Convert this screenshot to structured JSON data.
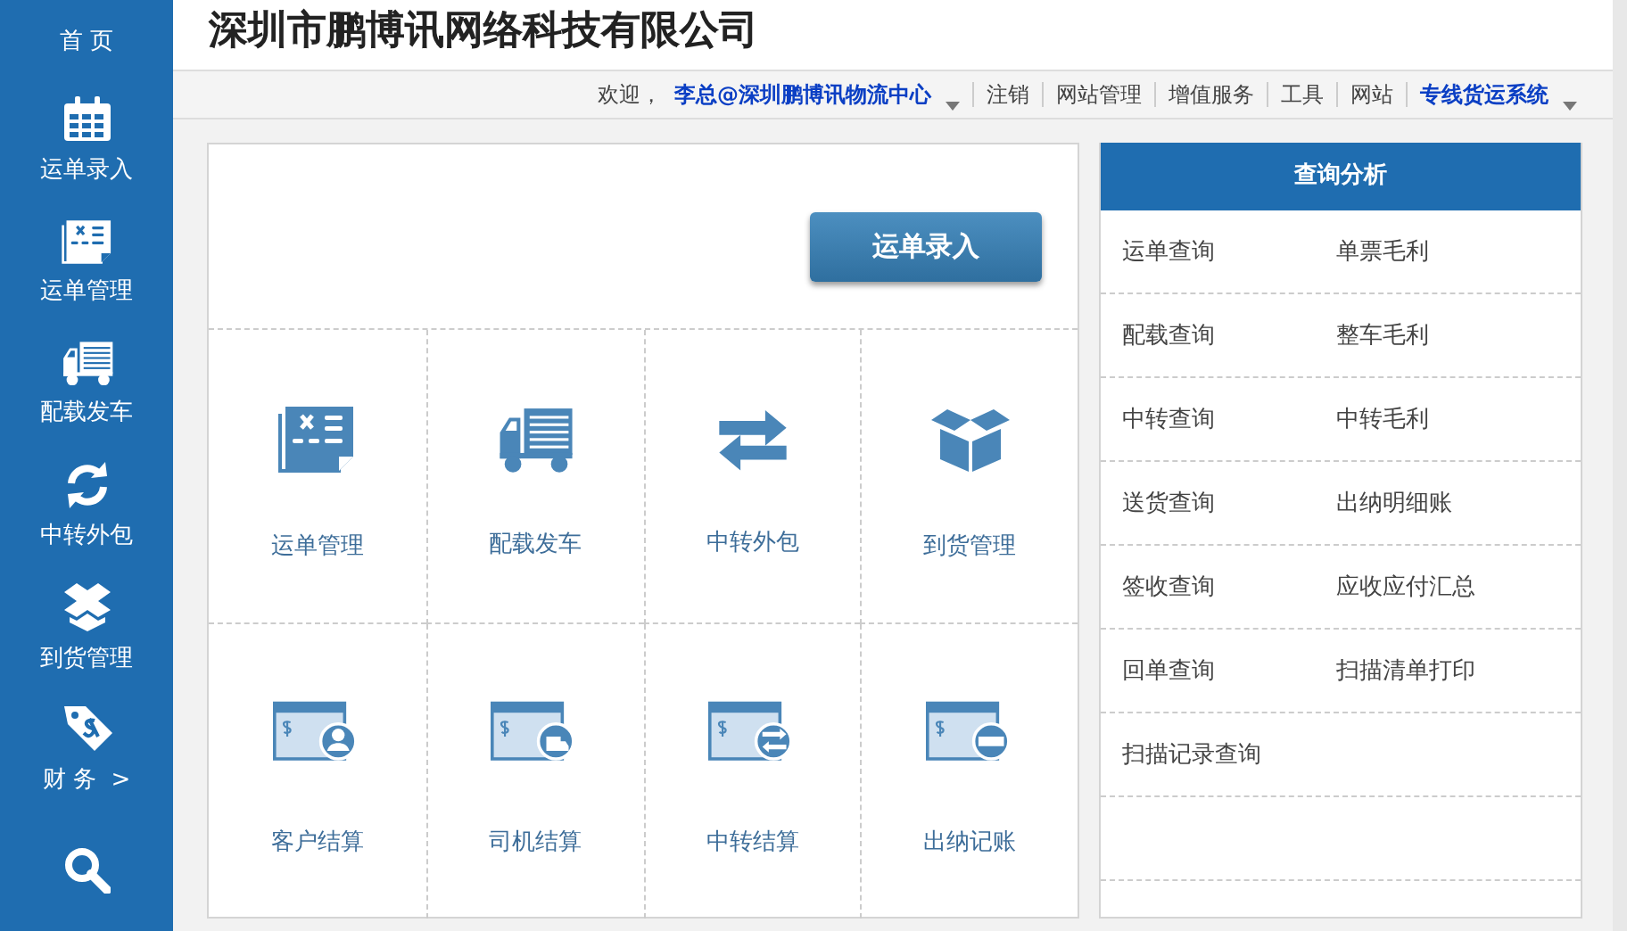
{
  "sidebar": {
    "items": [
      {
        "label": "首 页"
      },
      {
        "label": "运单录入"
      },
      {
        "label": "运单管理"
      },
      {
        "label": "配载发车"
      },
      {
        "label": "中转外包"
      },
      {
        "label": "到货管理"
      },
      {
        "label": "财 务  >"
      }
    ]
  },
  "header": {
    "title": "深圳市鹏博讯网络科技有限公司"
  },
  "nav": [
    {
      "kind": "text",
      "label": "欢迎，"
    },
    {
      "kind": "menu",
      "label": "李总@深圳鹏博讯物流中心"
    },
    {
      "kind": "link",
      "label": "注销"
    },
    {
      "kind": "link",
      "label": "网站管理"
    },
    {
      "kind": "link",
      "label": "增值服务"
    },
    {
      "kind": "link",
      "label": "工具"
    },
    {
      "kind": "link",
      "label": "网站"
    },
    {
      "kind": "menu",
      "label": "专线货运系统"
    }
  ],
  "main": {
    "primary_button": "运单录入",
    "tiles": [
      {
        "label": "运单管理"
      },
      {
        "label": "配载发车"
      },
      {
        "label": "中转外包"
      },
      {
        "label": "到货管理"
      },
      {
        "label": "客户结算"
      },
      {
        "label": "司机结算"
      },
      {
        "label": "中转结算"
      },
      {
        "label": "出纳记账"
      }
    ]
  },
  "query_panel": {
    "title": "查询分析",
    "rows": [
      [
        "运单查询",
        "单票毛利"
      ],
      [
        "配载查询",
        "整车毛利"
      ],
      [
        "中转查询",
        "中转毛利"
      ],
      [
        "送货查询",
        "出纳明细账"
      ],
      [
        "签收查询",
        "应收应付汇总"
      ],
      [
        "回单查询",
        "扫描清单打印"
      ],
      [
        "扫描记录查询"
      ],
      [],
      []
    ]
  }
}
